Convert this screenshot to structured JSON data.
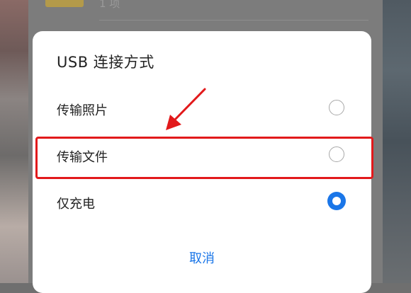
{
  "background": {
    "partial_list_item_text": "1 项"
  },
  "dialog": {
    "title": "USB 连接方式",
    "options": [
      {
        "label": "传输照片",
        "selected": false
      },
      {
        "label": "传输文件",
        "selected": false
      },
      {
        "label": "仅充电",
        "selected": true
      }
    ],
    "cancel_label": "取消"
  },
  "colors": {
    "accent": "#1a76e8",
    "annotation": "#e2191b"
  }
}
